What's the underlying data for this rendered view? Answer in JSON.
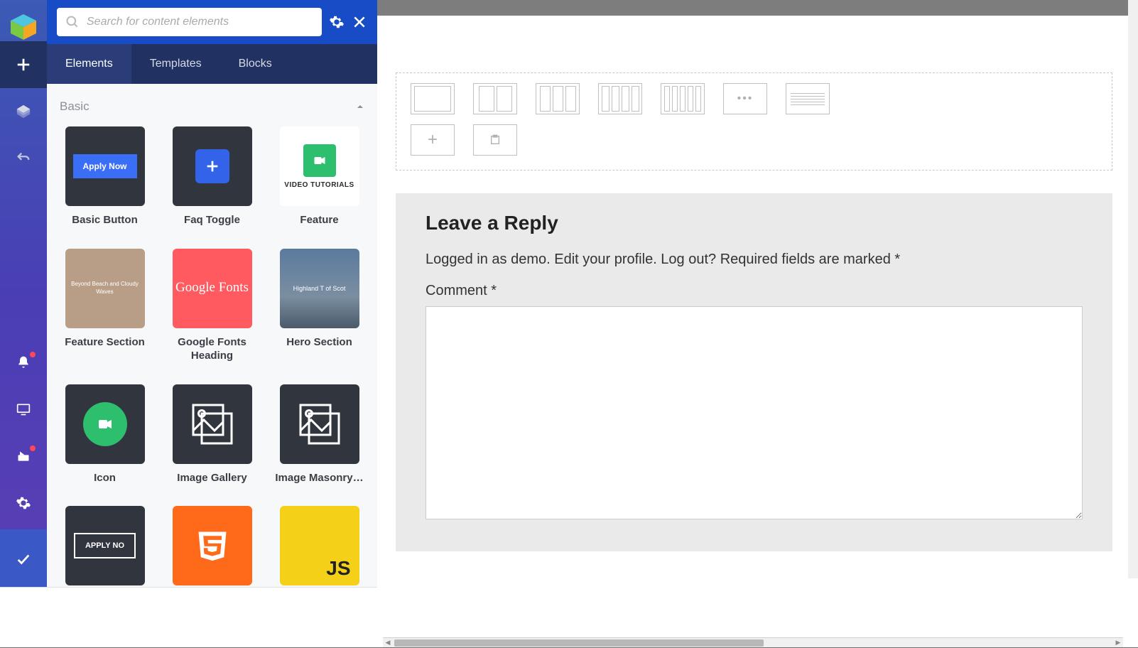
{
  "search": {
    "placeholder": "Search for content elements"
  },
  "tabs": {
    "elements": "Elements",
    "templates": "Templates",
    "blocks": "Blocks"
  },
  "section": {
    "basic": "Basic"
  },
  "elements": {
    "basic_button": "Basic Button",
    "apply_now": "Apply Now",
    "faq_toggle": "Faq Toggle",
    "feature": "Feature",
    "video_tutorials": "VIDEO TUTORIALS",
    "feature_section": "Feature Section",
    "fs_title": "Beyond Beach and Cloudy Waves",
    "google_fonts": "Google Fonts Heading",
    "gf_text": "Google Fonts",
    "hero_section": "Hero Section",
    "hero_text": "Highland T of Scot",
    "icon": "Icon",
    "image_gallery": "Image Gallery",
    "image_masonry": "Image Masonry…",
    "apply_now_b": "APPLY NO",
    "js": "JS"
  },
  "reply": {
    "title": "Leave a Reply",
    "intro": "Logged in as demo. Edit your profile. Log out? Required fields are marked *",
    "comment_label": "Comment *"
  },
  "dots": "•••"
}
